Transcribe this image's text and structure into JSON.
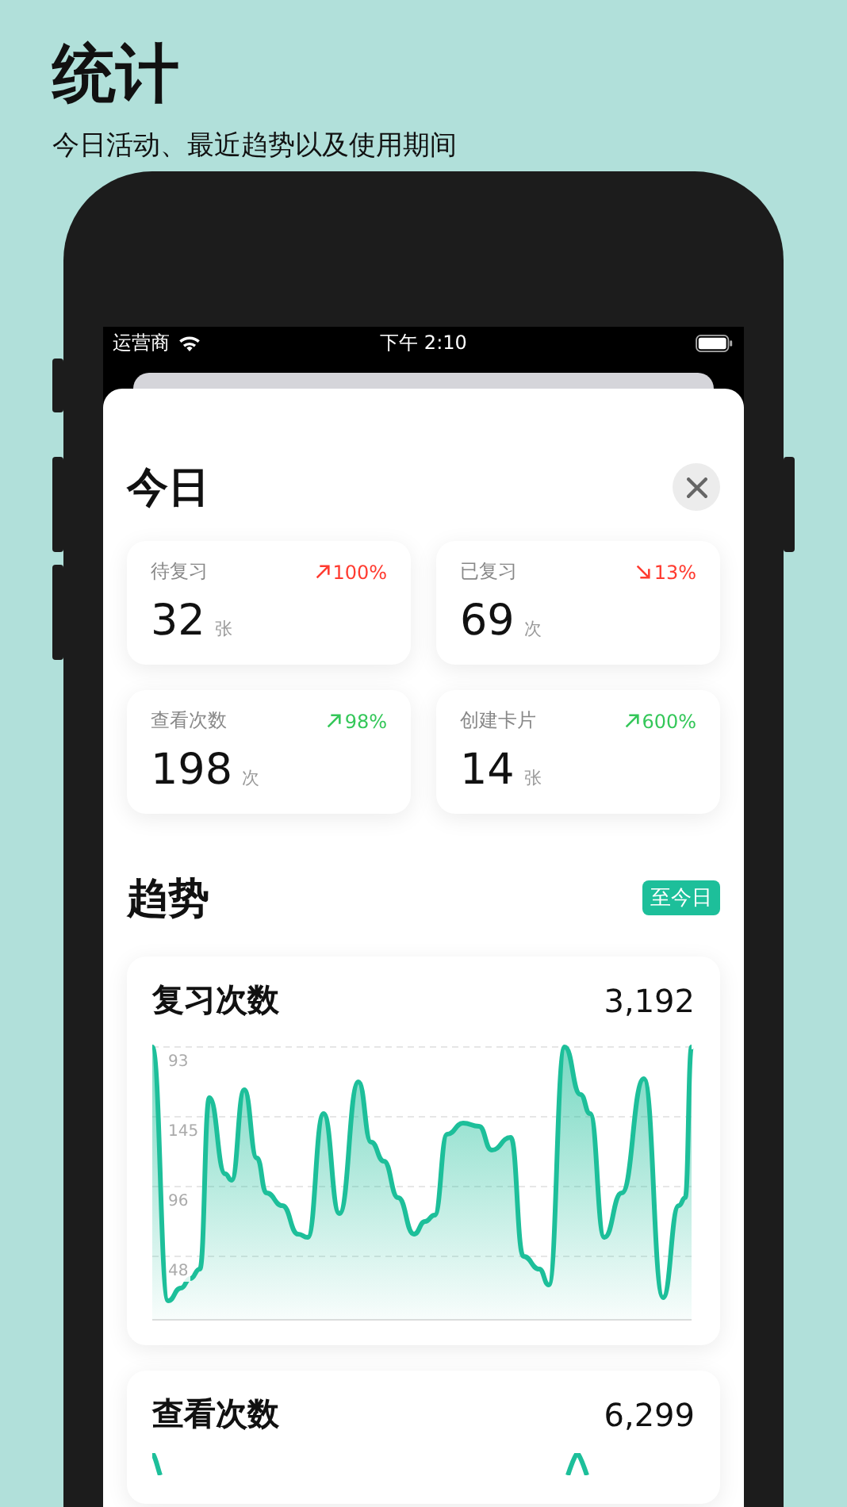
{
  "header": {
    "title": "统计",
    "subtitle": "今日活动、最近趋势以及使用期间"
  },
  "status_bar": {
    "carrier": "运营商",
    "time": "下午 2:10"
  },
  "today": {
    "title": "今日",
    "cards": [
      {
        "label": "待复习",
        "change": "100%",
        "kind": "up",
        "color": "#ff3b30",
        "value": "32",
        "unit": "张"
      },
      {
        "label": "已复习",
        "change": "13%",
        "kind": "down",
        "color": "#ff3b30",
        "value": "69",
        "unit": "次"
      },
      {
        "label": "查看次数",
        "change": "98%",
        "kind": "up",
        "color": "#34c759",
        "value": "198",
        "unit": "次"
      },
      {
        "label": "创建卡片",
        "change": "600%",
        "kind": "up",
        "color": "#34c759",
        "value": "14",
        "unit": "张"
      }
    ]
  },
  "trends": {
    "title": "趋势",
    "range_badge": "至今日",
    "charts": [
      {
        "title": "复习次数",
        "total": "3,192",
        "y_labels": [
          "93",
          "145",
          "96",
          "48"
        ]
      },
      {
        "title": "查看次数",
        "total": "6,299"
      }
    ]
  }
}
